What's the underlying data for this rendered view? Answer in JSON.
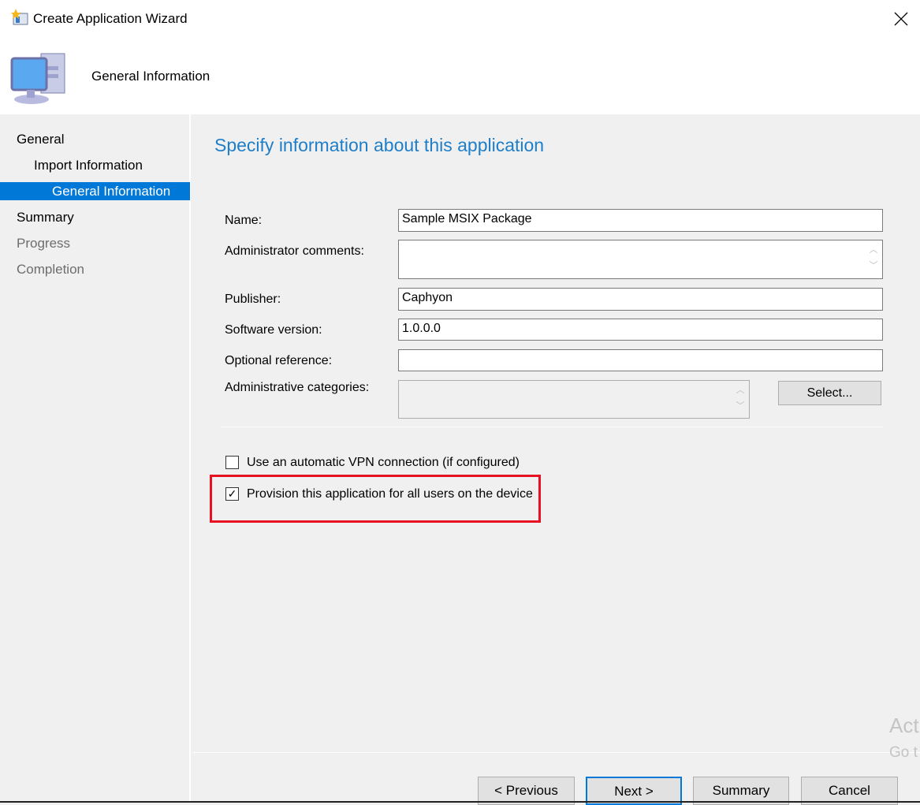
{
  "window": {
    "title": "Create Application Wizard",
    "close_icon": "close-icon"
  },
  "header": {
    "title": "General Information"
  },
  "sidebar": {
    "items": [
      {
        "label": "General",
        "state": "normal"
      },
      {
        "label": "Import Information",
        "state": "normal"
      },
      {
        "label": "General Information",
        "state": "selected"
      },
      {
        "label": "Summary",
        "state": "normal"
      },
      {
        "label": "Progress",
        "state": "disabled"
      },
      {
        "label": "Completion",
        "state": "disabled"
      }
    ]
  },
  "main": {
    "heading": "Specify information about this application",
    "fields": {
      "name": {
        "label": "Name:",
        "value": "Sample MSIX Package"
      },
      "comments": {
        "label": "Administrator comments:",
        "value": ""
      },
      "publisher": {
        "label": "Publisher:",
        "value": "Caphyon"
      },
      "version": {
        "label": "Software version:",
        "value": "1.0.0.0"
      },
      "reference": {
        "label": "Optional reference:",
        "value": ""
      },
      "categories": {
        "label": "Administrative categories:",
        "value": ""
      }
    },
    "select_button": "Select...",
    "vpn": {
      "label": "Use an automatic VPN connection (if configured)",
      "checked": false
    },
    "provision": {
      "label": "Provision this application for all users on the device",
      "checked": true
    },
    "highlight_color": "#e81123"
  },
  "footer": {
    "previous": "< Previous",
    "next": "Next >",
    "summary": "Summary",
    "cancel": "Cancel"
  },
  "watermark": {
    "line1": "Act",
    "line2": "Go t"
  },
  "colors": {
    "accent": "#0078d7",
    "heading": "#1e7ec8"
  }
}
